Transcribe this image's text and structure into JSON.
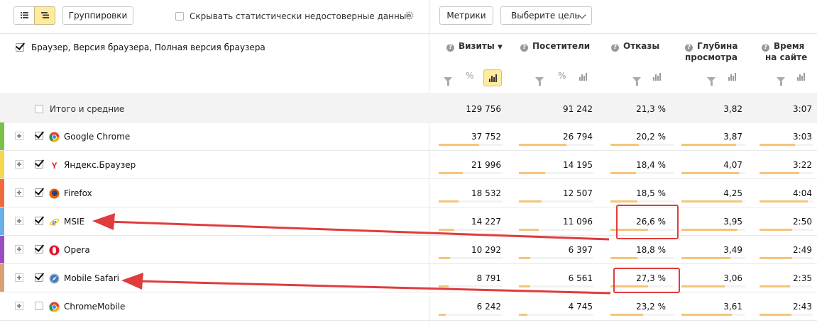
{
  "toolbar": {
    "groupings_label": "Группировки",
    "hide_unreliable_label": "Скрывать статистически недостоверные данные",
    "metrics_label": "Метрики",
    "goal_label": "Выберите цель"
  },
  "table": {
    "dimension_title": "Браузер, Версия браузера, Полная версия браузера",
    "columns": {
      "visits": "Визиты",
      "visitors": "Посетители",
      "bounces": "Отказы",
      "depth_l1": "Глубина",
      "depth_l2": "просмотра",
      "time_l1": "Время",
      "time_l2": "на сайте"
    },
    "percent_sign": "%",
    "totals": {
      "label": "Итого и средние",
      "visits": "129 756",
      "visitors": "91 242",
      "bounces": "21,3 %",
      "depth": "3,82",
      "time": "3:07"
    },
    "rows": [
      {
        "name": "Google Chrome",
        "icon": "chrome-icon",
        "color": "#7cc04a",
        "checked": true,
        "visits": "37 752",
        "visitors": "26 794",
        "bounces": "20,2 %",
        "depth": "3,87",
        "time": "3:03",
        "visits_share": 0.29,
        "visitors_share": 0.29,
        "bounce_level": 0.2,
        "depth_level": 0.39,
        "time_level": 0.3
      },
      {
        "name": "Яндекс.Браузер",
        "icon": "yandex-browser-icon",
        "color": "#f6d64a",
        "checked": true,
        "visits": "21 996",
        "visitors": "14 195",
        "bounces": "18,4 %",
        "depth": "4,07",
        "time": "3:22",
        "visits_share": 0.17,
        "visitors_share": 0.16,
        "bounce_level": 0.18,
        "depth_level": 0.41,
        "time_level": 0.34
      },
      {
        "name": "Firefox",
        "icon": "firefox-icon",
        "color": "#f06a3c",
        "checked": true,
        "visits": "18 532",
        "visitors": "12 507",
        "bounces": "18,5 %",
        "depth": "4,25",
        "time": "4:04",
        "visits_share": 0.14,
        "visitors_share": 0.14,
        "bounce_level": 0.19,
        "depth_level": 0.43,
        "time_level": 0.41
      },
      {
        "name": "MSIE",
        "icon": "ie-icon",
        "color": "#6ab0e6",
        "checked": true,
        "visits": "14 227",
        "visitors": "11 096",
        "bounces": "26,6 %",
        "depth": "3,95",
        "time": "2:50",
        "visits_share": 0.11,
        "visitors_share": 0.12,
        "bounce_level": 0.27,
        "depth_level": 0.4,
        "time_level": 0.28
      },
      {
        "name": "Opera",
        "icon": "opera-icon",
        "color": "#9a4dc0",
        "checked": true,
        "visits": "10 292",
        "visitors": "6 397",
        "bounces": "18,8 %",
        "depth": "3,49",
        "time": "2:49",
        "visits_share": 0.08,
        "visitors_share": 0.07,
        "bounce_level": 0.19,
        "depth_level": 0.35,
        "time_level": 0.28
      },
      {
        "name": "Mobile Safari",
        "icon": "safari-icon",
        "color": "#d8a074",
        "checked": true,
        "visits": "8 791",
        "visitors": "6 561",
        "bounces": "27,3 %",
        "depth": "3,06",
        "time": "2:35",
        "visits_share": 0.07,
        "visitors_share": 0.07,
        "bounce_level": 0.27,
        "depth_level": 0.31,
        "time_level": 0.26
      },
      {
        "name": "ChromeMobile",
        "icon": "chrome-icon",
        "color": "",
        "checked": false,
        "visits": "6 242",
        "visitors": "4 745",
        "bounces": "23,2 %",
        "depth": "3,61",
        "time": "2:43",
        "visits_share": 0.05,
        "visitors_share": 0.05,
        "bounce_level": 0.23,
        "depth_level": 0.36,
        "time_level": 0.27
      }
    ]
  },
  "colors": {
    "accent": "#ffeba0",
    "bar_fill": "#f6c47a",
    "annotation": "#e03c3c"
  }
}
